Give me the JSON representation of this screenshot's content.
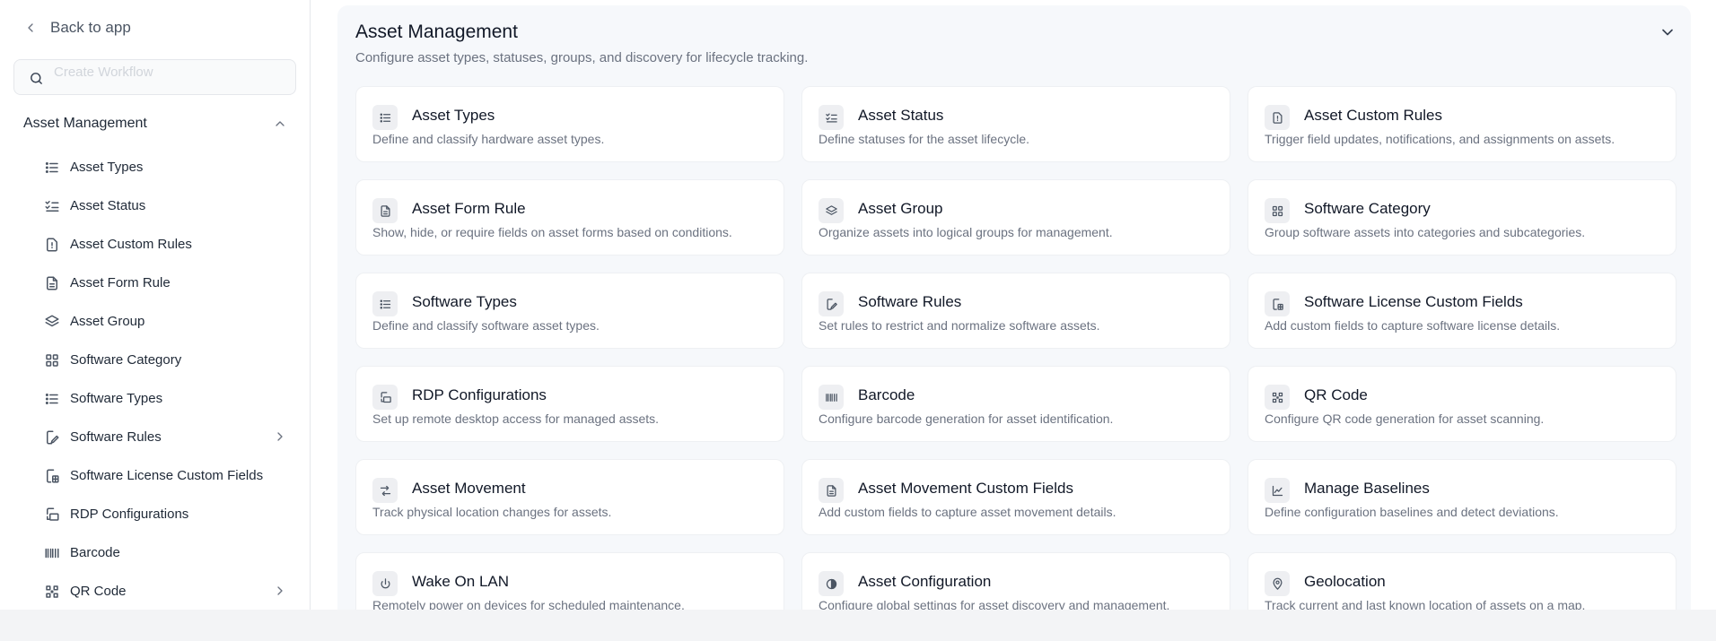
{
  "sidebar": {
    "back_label": "Back to app",
    "search_placeholder": "Create Workflow",
    "section_title": "Asset Management",
    "items": [
      {
        "label": "Asset Types",
        "icon": "list-icon"
      },
      {
        "label": "Asset Status",
        "icon": "checklist-icon"
      },
      {
        "label": "Asset Custom Rules",
        "icon": "file-alert-icon"
      },
      {
        "label": "Asset Form Rule",
        "icon": "file-text-icon"
      },
      {
        "label": "Asset Group",
        "icon": "layers-icon"
      },
      {
        "label": "Software Category",
        "icon": "grid-icon"
      },
      {
        "label": "Software Types",
        "icon": "list-icon"
      },
      {
        "label": "Software Rules",
        "icon": "file-edit-icon"
      },
      {
        "label": "Software License Custom Fields",
        "icon": "file-grid-icon"
      },
      {
        "label": "RDP Configurations",
        "icon": "remote-icon"
      },
      {
        "label": "Barcode",
        "icon": "barcode-icon"
      },
      {
        "label": "QR Code",
        "icon": "qr-code-icon"
      }
    ]
  },
  "main": {
    "title": "Asset Management",
    "subtitle": "Configure asset types, statuses, groups, and discovery for lifecycle tracking.",
    "cards": [
      {
        "title": "Asset Types",
        "desc": "Define and classify hardware asset types.",
        "icon": "list-icon"
      },
      {
        "title": "Asset Status",
        "desc": "Define statuses for the asset lifecycle.",
        "icon": "checklist-icon"
      },
      {
        "title": "Asset Custom Rules",
        "desc": "Trigger field updates, notifications, and assignments on assets.",
        "icon": "file-alert-icon"
      },
      {
        "title": "Asset Form Rule",
        "desc": "Show, hide, or require fields on asset forms based on conditions.",
        "icon": "file-text-icon"
      },
      {
        "title": "Asset Group",
        "desc": "Organize assets into logical groups for management.",
        "icon": "layers-icon"
      },
      {
        "title": "Software Category",
        "desc": "Group software assets into categories and subcategories.",
        "icon": "grid-icon"
      },
      {
        "title": "Software Types",
        "desc": "Define and classify software asset types.",
        "icon": "list-icon"
      },
      {
        "title": "Software Rules",
        "desc": "Set rules to restrict and normalize software assets.",
        "icon": "file-edit-icon"
      },
      {
        "title": "Software License Custom Fields",
        "desc": "Add custom fields to capture software license details.",
        "icon": "file-grid-icon"
      },
      {
        "title": "RDP Configurations",
        "desc": "Set up remote desktop access for managed assets.",
        "icon": "remote-icon"
      },
      {
        "title": "Barcode",
        "desc": "Configure barcode generation for asset identification.",
        "icon": "barcode-icon"
      },
      {
        "title": "QR Code",
        "desc": "Configure QR code generation for asset scanning.",
        "icon": "qr-code-icon"
      },
      {
        "title": "Asset Movement",
        "desc": "Track physical location changes for assets.",
        "icon": "movement-icon"
      },
      {
        "title": "Asset Movement Custom Fields",
        "desc": "Add custom fields to capture asset movement details.",
        "icon": "file-text-icon"
      },
      {
        "title": "Manage Baselines",
        "desc": "Define configuration baselines and detect deviations.",
        "icon": "chart-line-icon"
      },
      {
        "title": "Wake On LAN",
        "desc": "Remotely power on devices for scheduled maintenance.",
        "icon": "power-icon"
      },
      {
        "title": "Asset Configuration",
        "desc": "Configure global settings for asset discovery and management.",
        "icon": "contrast-icon"
      },
      {
        "title": "Geolocation",
        "desc": "Track current and last known location of assets on a map.",
        "icon": "map-pin-icon"
      }
    ]
  }
}
